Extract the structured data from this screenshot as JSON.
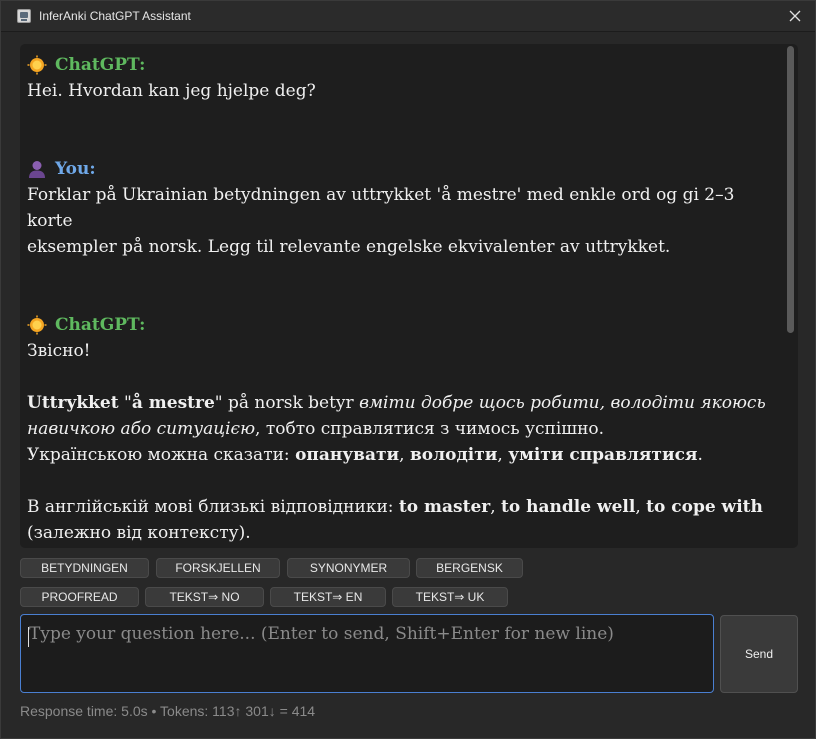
{
  "window": {
    "title": "InferAnki ChatGPT Assistant"
  },
  "chat": {
    "bot_name": "ChatGPT:",
    "user_name": "You:",
    "messages": {
      "greeting": "Hei. Hvordan kan jeg hjelpe deg?",
      "user_line1": "Forklar på Ukrainian betydningen av uttrykket 'å mestre' med enkle ord og gi 2–3 korte",
      "user_line2": "eksempler på norsk. Legg til relevante engelske ekvivalenter av uttrykket.",
      "reply_intro": "Звісно!",
      "reply_p1_bold1": "Uttrykket",
      "reply_p1_quote_open": " \"",
      "reply_p1_bold2": "å mestre",
      "reply_p1_quote_close": "\" på norsk betyr ",
      "reply_p1_italic_line1": "вміти добре щось робити, володіти якоюсь",
      "reply_p1_italic_line2": "навичкою або ситуацією",
      "reply_p1_rest": ", тобто справлятися з чимось успішно.",
      "reply_p2_text": "Українською можна сказати: ",
      "reply_p2_b1": "опанувати",
      "reply_p2_sep1": ", ",
      "reply_p2_b2": "володіти",
      "reply_p2_sep2": ", ",
      "reply_p2_b3": "уміти справлятися",
      "reply_p2_end": ".",
      "reply_p3_text": "В англійській мові близькі відповідники: ",
      "reply_p3_b1": "to master",
      "reply_p3_sep1": ", ",
      "reply_p3_b2": "to handle well",
      "reply_p3_sep2": ", ",
      "reply_p3_b3": "to cope with",
      "reply_p3_line2": "(залежно від контексту).",
      "separator": "---"
    }
  },
  "quick_buttons": {
    "row1": [
      "BETYDNINGEN",
      "FORSKJELLEN",
      "SYNONYMER",
      "BERGENSK"
    ],
    "row2": [
      "PROOFREAD",
      "TEKST⇒ NO",
      "TEKST⇒ EN",
      "TEKST⇒ UK"
    ]
  },
  "input": {
    "placeholder": "Type your question here... (Enter to send, Shift+Enter for new line)",
    "value": ""
  },
  "send_button": {
    "label": "Send"
  },
  "status_bar": {
    "text": "Response time: 5.0s • Tokens: 113↑ 301↓ = 414"
  },
  "icons": {
    "bot": "sun-icon",
    "user": "person-icon",
    "close": "close-icon",
    "app": "app-icon"
  },
  "colors": {
    "bot_name": "#5fb95f",
    "user_name": "#6fa8e8",
    "input_focus_border": "#4a7fd1"
  }
}
